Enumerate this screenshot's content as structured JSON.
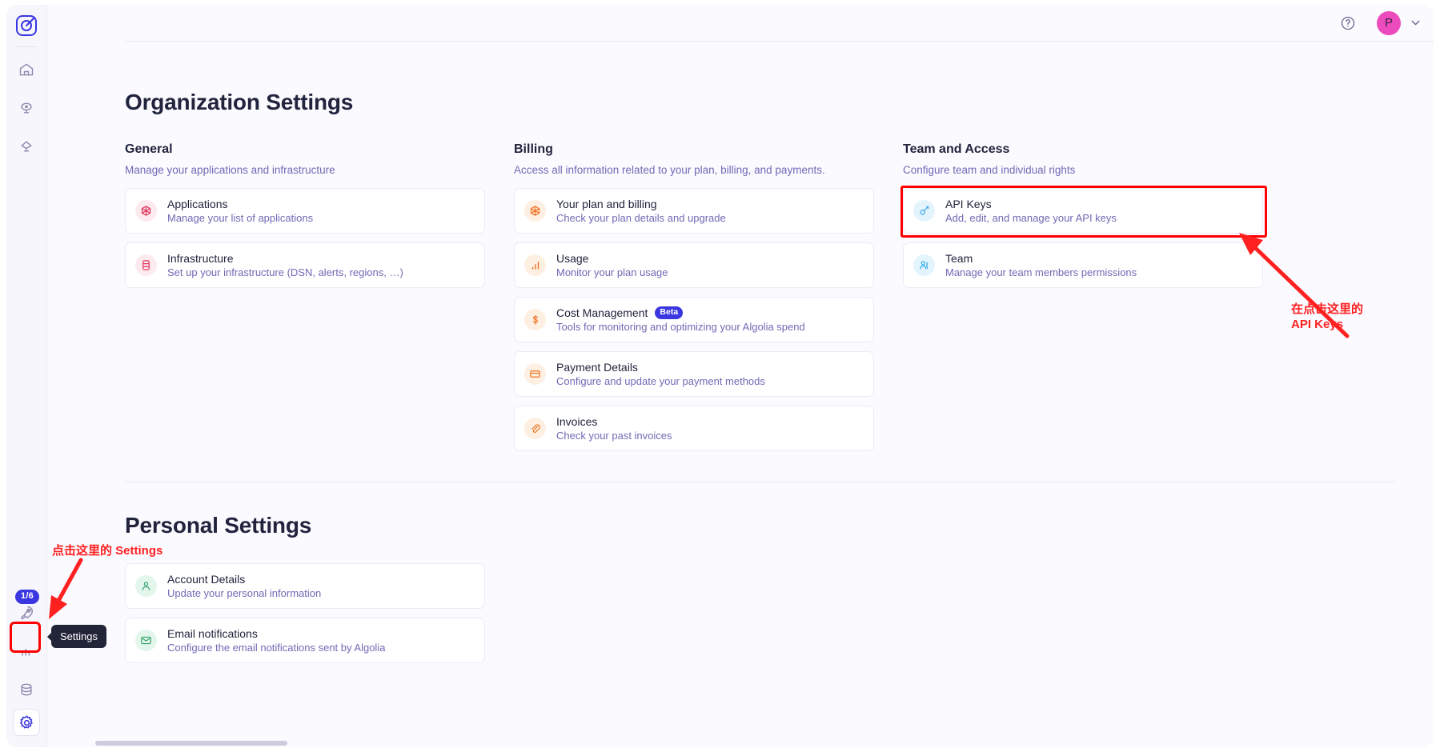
{
  "window": {
    "background": "#fbfaff"
  },
  "rail": {
    "logo_icon": "algolia-logo-icon",
    "items": [
      {
        "icon": "home-icon",
        "name": "home"
      },
      {
        "icon": "search-pin-icon",
        "name": "search"
      },
      {
        "icon": "recommend-icon",
        "name": "recommend"
      }
    ],
    "bottom_items": [
      {
        "icon": "rocket-icon",
        "name": "onboarding",
        "badge": "1/6"
      },
      {
        "icon": "bar-chart-icon",
        "name": "analytics"
      },
      {
        "icon": "database-icon",
        "name": "data-sources"
      },
      {
        "icon": "gear-icon",
        "name": "settings"
      }
    ],
    "settings_tooltip": "Settings"
  },
  "topbar": {
    "help_icon": "question-circle-icon",
    "avatar_initial": "P",
    "avatar_color": "#ec4bbd",
    "chevron_icon": "chevron-down-icon"
  },
  "main": {
    "page_title": "Organization Settings",
    "columns": [
      {
        "title": "General",
        "subtitle": "Manage your applications and infrastructure",
        "cards": [
          {
            "title": "Applications",
            "subtitle": "Manage your list of applications",
            "icon": "cube-icon",
            "icon_color": "#e0355a",
            "icon_bg": "#fdeaee"
          },
          {
            "title": "Infrastructure",
            "subtitle": "Set up your infrastructure (DSN, alerts, regions, …)",
            "icon": "database-icon",
            "icon_color": "#e0355a",
            "icon_bg": "#fdeaee"
          }
        ]
      },
      {
        "title": "Billing",
        "subtitle": "Access all information related to your plan, billing, and payments.",
        "cards": [
          {
            "title": "Your plan and billing",
            "subtitle": "Check your plan details and upgrade",
            "icon": "cube-icon",
            "icon_color": "#f0711f",
            "icon_bg": "#fdf0e3"
          },
          {
            "title": "Usage",
            "subtitle": "Monitor your plan usage",
            "icon": "bar-chart-icon",
            "icon_color": "#f0711f",
            "icon_bg": "#fdf0e3"
          },
          {
            "title": "Cost Management",
            "badge": "Beta",
            "subtitle": "Tools for monitoring and optimizing your Algolia spend",
            "icon": "dollar-icon",
            "icon_color": "#f0711f",
            "icon_bg": "#fdf0e3"
          },
          {
            "title": "Payment Details",
            "subtitle": "Configure and update your payment methods",
            "icon": "credit-card-icon",
            "icon_color": "#f0711f",
            "icon_bg": "#fdf0e3"
          },
          {
            "title": "Invoices",
            "subtitle": "Check your past invoices",
            "icon": "paperclip-icon",
            "icon_color": "#f0711f",
            "icon_bg": "#fdf0e3"
          }
        ]
      },
      {
        "title": "Team and Access",
        "subtitle": "Configure team and individual rights",
        "cards": [
          {
            "title": "API Keys",
            "subtitle": "Add, edit, and manage your API keys",
            "icon": "key-icon",
            "icon_color": "#2fa8e8",
            "icon_bg": "#e4f4fd",
            "highlighted": true
          },
          {
            "title": "Team",
            "subtitle": "Manage your team members permissions",
            "icon": "users-icon",
            "icon_color": "#2fa8e8",
            "icon_bg": "#e4f4fd"
          }
        ]
      }
    ],
    "personal": {
      "title": "Personal Settings",
      "cards": [
        {
          "title": "Account Details",
          "subtitle": "Update your personal information",
          "icon": "user-icon",
          "icon_color": "#31a06a",
          "icon_bg": "#e3f6ec"
        },
        {
          "title": "Email notifications",
          "subtitle": "Configure the email notifications sent by Algolia",
          "icon": "envelope-icon",
          "icon_color": "#31a06a",
          "icon_bg": "#e3f6ec"
        }
      ]
    }
  },
  "annotations": {
    "color": "#ff2020",
    "api_keys_note": "在点击这里的\nAPI Keys",
    "settings_note": "点击这里的 Settings"
  }
}
